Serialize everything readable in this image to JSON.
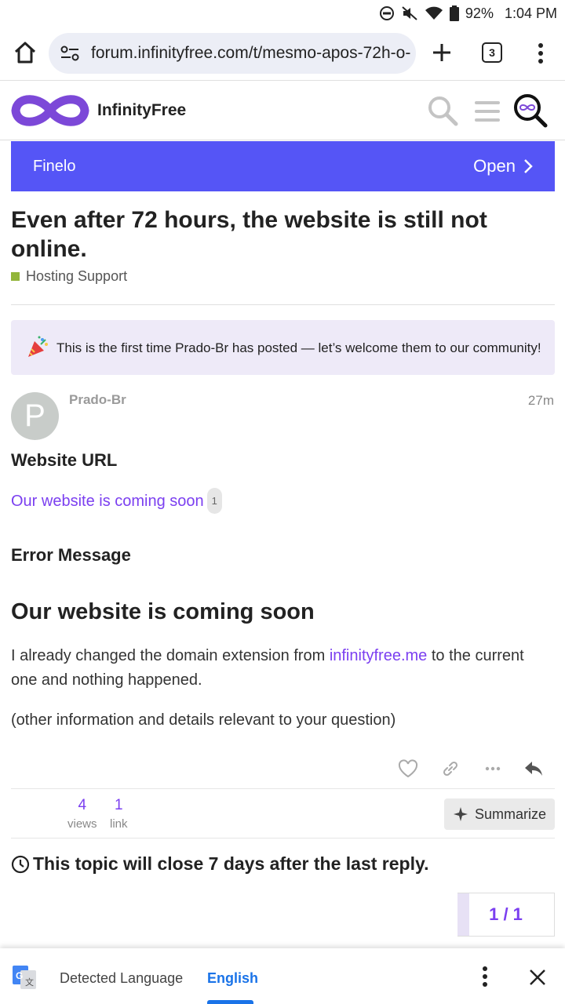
{
  "status_bar": {
    "battery": "92%",
    "time": "1:04 PM",
    "icons": [
      "dnd-icon",
      "mute-icon",
      "wifi-icon",
      "battery-icon"
    ]
  },
  "browser": {
    "url": "forum.infinityfree.com/t/mesmo-apos-72h-o-",
    "tab_count": "3"
  },
  "site_header": {
    "brand": "InfinityFree"
  },
  "ad_banner": {
    "name": "Finelo",
    "cta": "Open"
  },
  "topic": {
    "title": "Even after 72 hours, the website is still not online.",
    "category": "Hosting Support",
    "category_color": "#92b53a"
  },
  "welcome_notice": "This is the first time Prado-Br has posted — let’s welcome them to our community!",
  "post": {
    "avatar_letter": "P",
    "author": "Prado-Br",
    "age": "27m",
    "website_url_heading": "Website URL",
    "website_link": "Our website is coming soon",
    "website_link_clicks": "1",
    "error_heading": "Error Message",
    "error_text": "Our website is coming soon",
    "body_pre": "I already changed the domain extension from ",
    "body_link": "infinityfree.me",
    "body_post": " to the current one and nothing happened.",
    "body_2": "(other information and details relevant to your question)"
  },
  "stats": {
    "views_count": "4",
    "views_label": "views",
    "links_count": "1",
    "links_label": "link",
    "summarize_label": "Summarize"
  },
  "close_notice": "This topic will close 7 days after the last reply.",
  "progress": "1 / 1",
  "translate_bar": {
    "detected": "Detected Language",
    "english": "English"
  },
  "colors": {
    "accent": "#7b3ff0",
    "banner": "#5555f6",
    "welcome_bg": "#eeeaf8"
  }
}
